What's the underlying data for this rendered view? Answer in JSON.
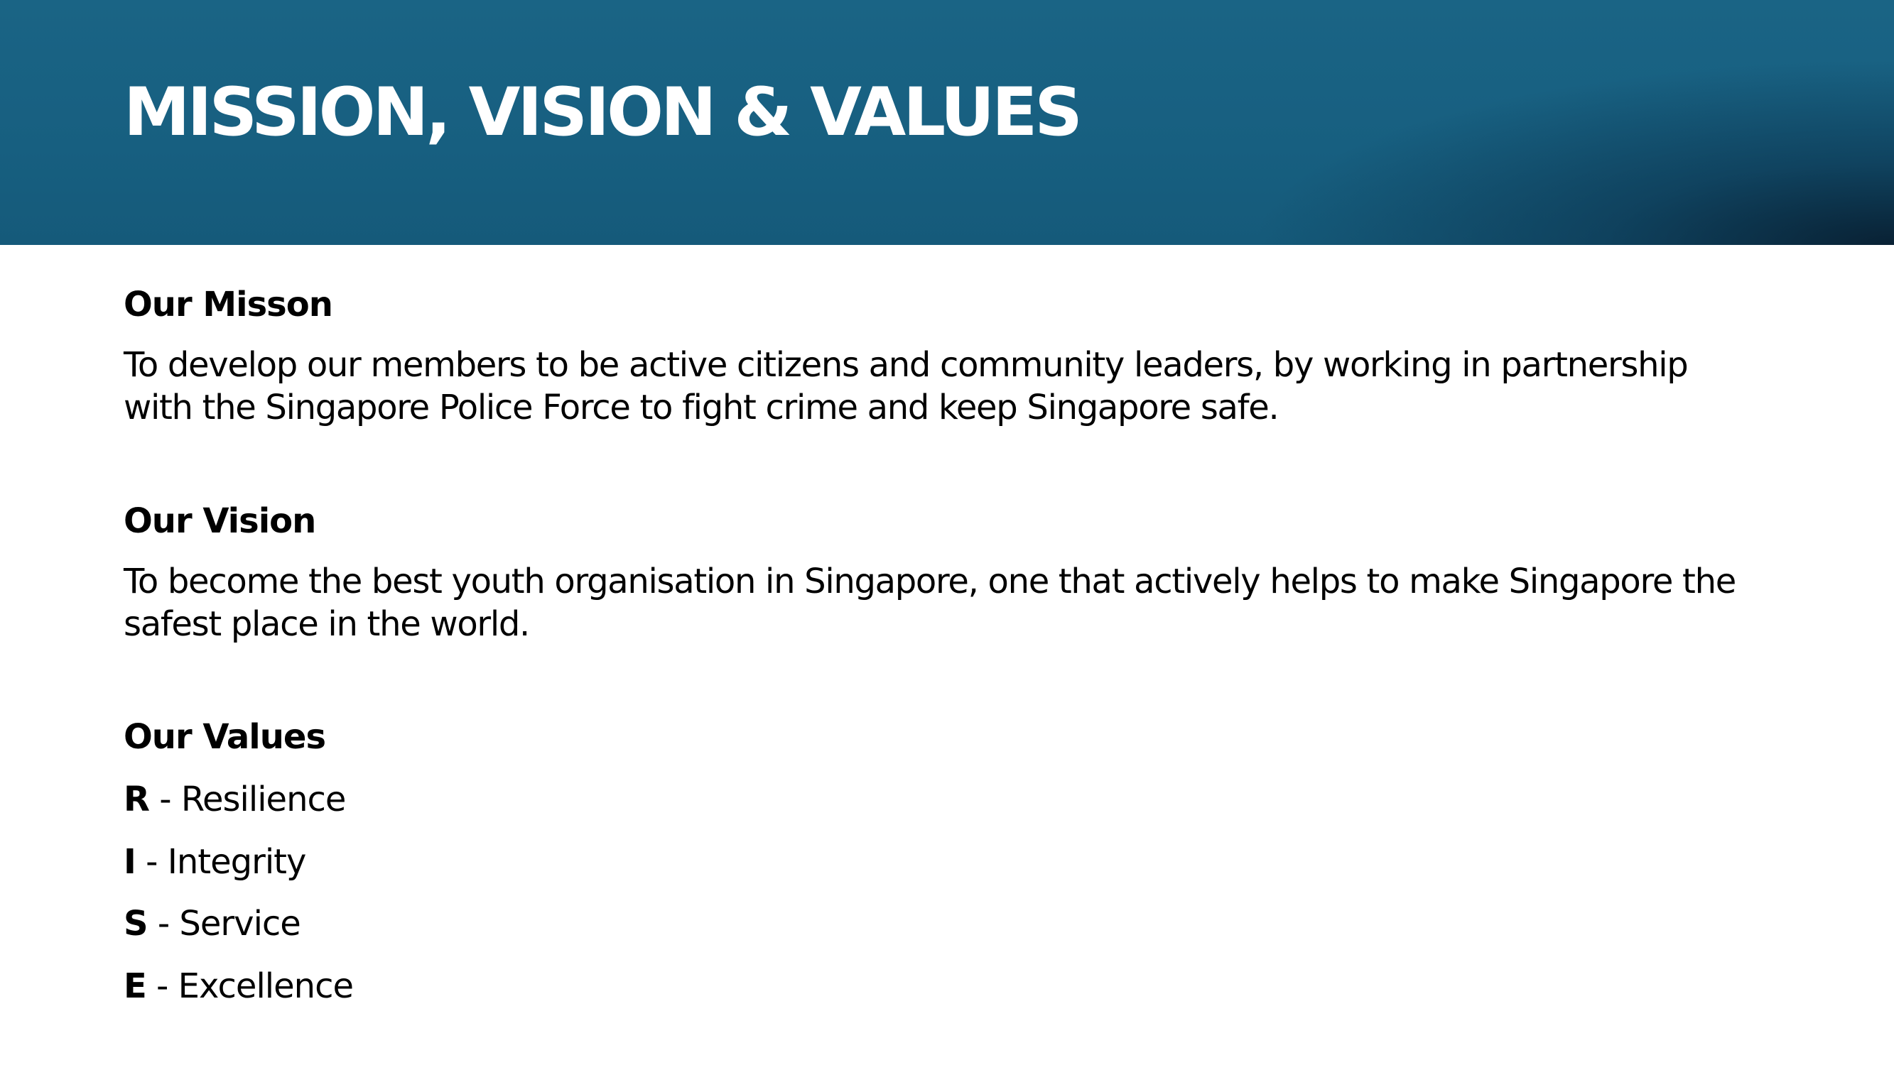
{
  "header": {
    "title": "MISSION, VISION & VALUES"
  },
  "mission": {
    "heading": "Our Misson",
    "lines": [
      "To develop our members to be active citizens and community leaders, by working in partnership",
      "with the Singapore Police Force to fight crime and keep Singapore safe."
    ]
  },
  "vision": {
    "heading": "Our Vision",
    "lines": [
      "To become the best youth organisation in Singapore, one that actively helps to make Singapore the",
      "safest place in the world."
    ]
  },
  "values": {
    "heading": "Our Values",
    "items": [
      {
        "letter": "R",
        "separator": " - ",
        "word": "Resilience"
      },
      {
        "letter": "I",
        "separator": " - ",
        "word": "Integrity"
      },
      {
        "letter": "S",
        "separator": " - ",
        "word": "Service"
      },
      {
        "letter": "E",
        "separator": " - ",
        "word": "Excellence"
      }
    ]
  },
  "colors": {
    "header_band": "#175f80",
    "header_title": "#ffffff",
    "body_text": "#000000"
  }
}
